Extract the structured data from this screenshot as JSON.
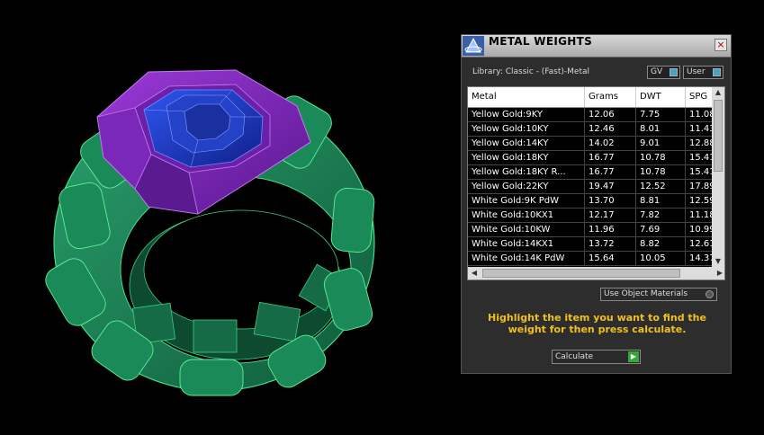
{
  "panel": {
    "title": "METAL WEIGHTS",
    "close_label": "×",
    "library_label": "Library: Classic - (Fast)-Metal",
    "toggle_gv": "GV",
    "toggle_user": "User",
    "columns": [
      "Metal",
      "Grams",
      "DWT",
      "SPG"
    ],
    "rows": [
      [
        "Yellow Gold:9KY",
        "12.06",
        "7.75",
        "11.08"
      ],
      [
        "Yellow Gold:10KY",
        "12.46",
        "8.01",
        "11.43"
      ],
      [
        "Yellow Gold:14KY",
        "14.02",
        "9.01",
        "12.88"
      ],
      [
        "Yellow Gold:18KY",
        "16.77",
        "10.78",
        "15.41"
      ],
      [
        "Yellow Gold:18KY R...",
        "16.77",
        "10.78",
        "15.41"
      ],
      [
        "Yellow Gold:22KY",
        "19.47",
        "12.52",
        "17.89"
      ],
      [
        "White Gold:9K PdW",
        "13.70",
        "8.81",
        "12.59"
      ],
      [
        "White Gold:10KX1",
        "12.17",
        "7.82",
        "11.18"
      ],
      [
        "White Gold:10KW",
        "11.96",
        "7.69",
        "10.99"
      ],
      [
        "White Gold:14KX1",
        "13.72",
        "8.82",
        "12.61"
      ],
      [
        "White Gold:14K PdW",
        "15.64",
        "10.05",
        "14.37"
      ]
    ],
    "use_object_materials": "Use Object Materials",
    "instructions": "Highlight the item you want to find the weight for then press calculate.",
    "calculate_label": "Calculate"
  },
  "icons": {
    "app": "app-logo-icon",
    "close": "close-icon",
    "scroll_up": "▲",
    "scroll_down": "▼",
    "scroll_left": "◀",
    "scroll_right": "▶",
    "calc_go": "▶"
  },
  "colors": {
    "ring_green": "#1f8a5a",
    "ring_purple": "#8a2bc8",
    "ring_blue": "#1f3fd0",
    "instruction_text": "#f0c020",
    "background": "#000000"
  }
}
